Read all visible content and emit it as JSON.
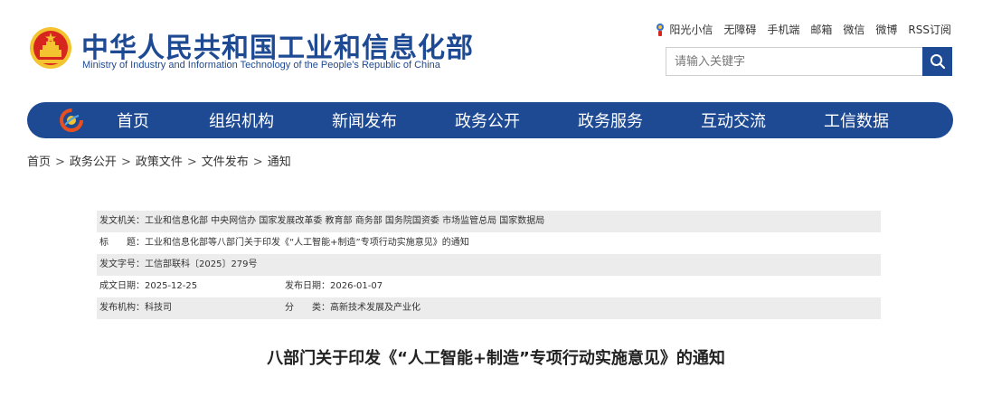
{
  "header": {
    "title": "中华人民共和国工业和信息化部",
    "subtitle": "Ministry of Industry and Information Technology of the People’s Republic of China",
    "top_links": [
      "阳光小信",
      "无障碍",
      "手机端",
      "邮箱",
      "微信",
      "微博",
      "RSS订阅"
    ],
    "search_placeholder": "请输入关键字"
  },
  "colors": {
    "brand_blue": "#1e4a93",
    "emblem_red": "#d7261e",
    "emblem_gold": "#f4c430",
    "row_shade": "#ececec"
  },
  "icons": {
    "emblem": "national-emblem-icon",
    "sunshine": "sunshine-mascot-icon",
    "search": "search-icon",
    "nav_logo": "miit-logo-icon"
  },
  "nav": {
    "items": [
      "首页",
      "组织机构",
      "新闻发布",
      "政务公开",
      "政务服务",
      "互动交流",
      "工信数据"
    ]
  },
  "breadcrumb": {
    "items": [
      "首页",
      "政务公开",
      "政策文件",
      "文件发布",
      "通知"
    ],
    "separator": ">"
  },
  "info": {
    "issuer_label": "发文机关：",
    "issuer_value": "工业和信息化部 中央网信办 国家发展改革委 教育部 商务部 国务院国资委 市场监管总局 国家数据局",
    "title_label": "标　　题：",
    "title_value": "工业和信息化部等八部门关于印发《“人工智能+制造”专项行动实施意见》的通知",
    "docno_label": "发文字号：",
    "docno_value": "工信部联科〔2025〕279号",
    "created_label": "成文日期：",
    "created_value": "2025-12-25",
    "published_label": "发布日期：",
    "published_value": "2026-01-07",
    "org_label": "发布机构：",
    "org_value": "科技司",
    "category_label": "分　　类：",
    "category_value": "高新技术发展及产业化"
  },
  "document": {
    "title": "八部门关于印发《“人工智能+制造”专项行动实施意见》的通知"
  }
}
